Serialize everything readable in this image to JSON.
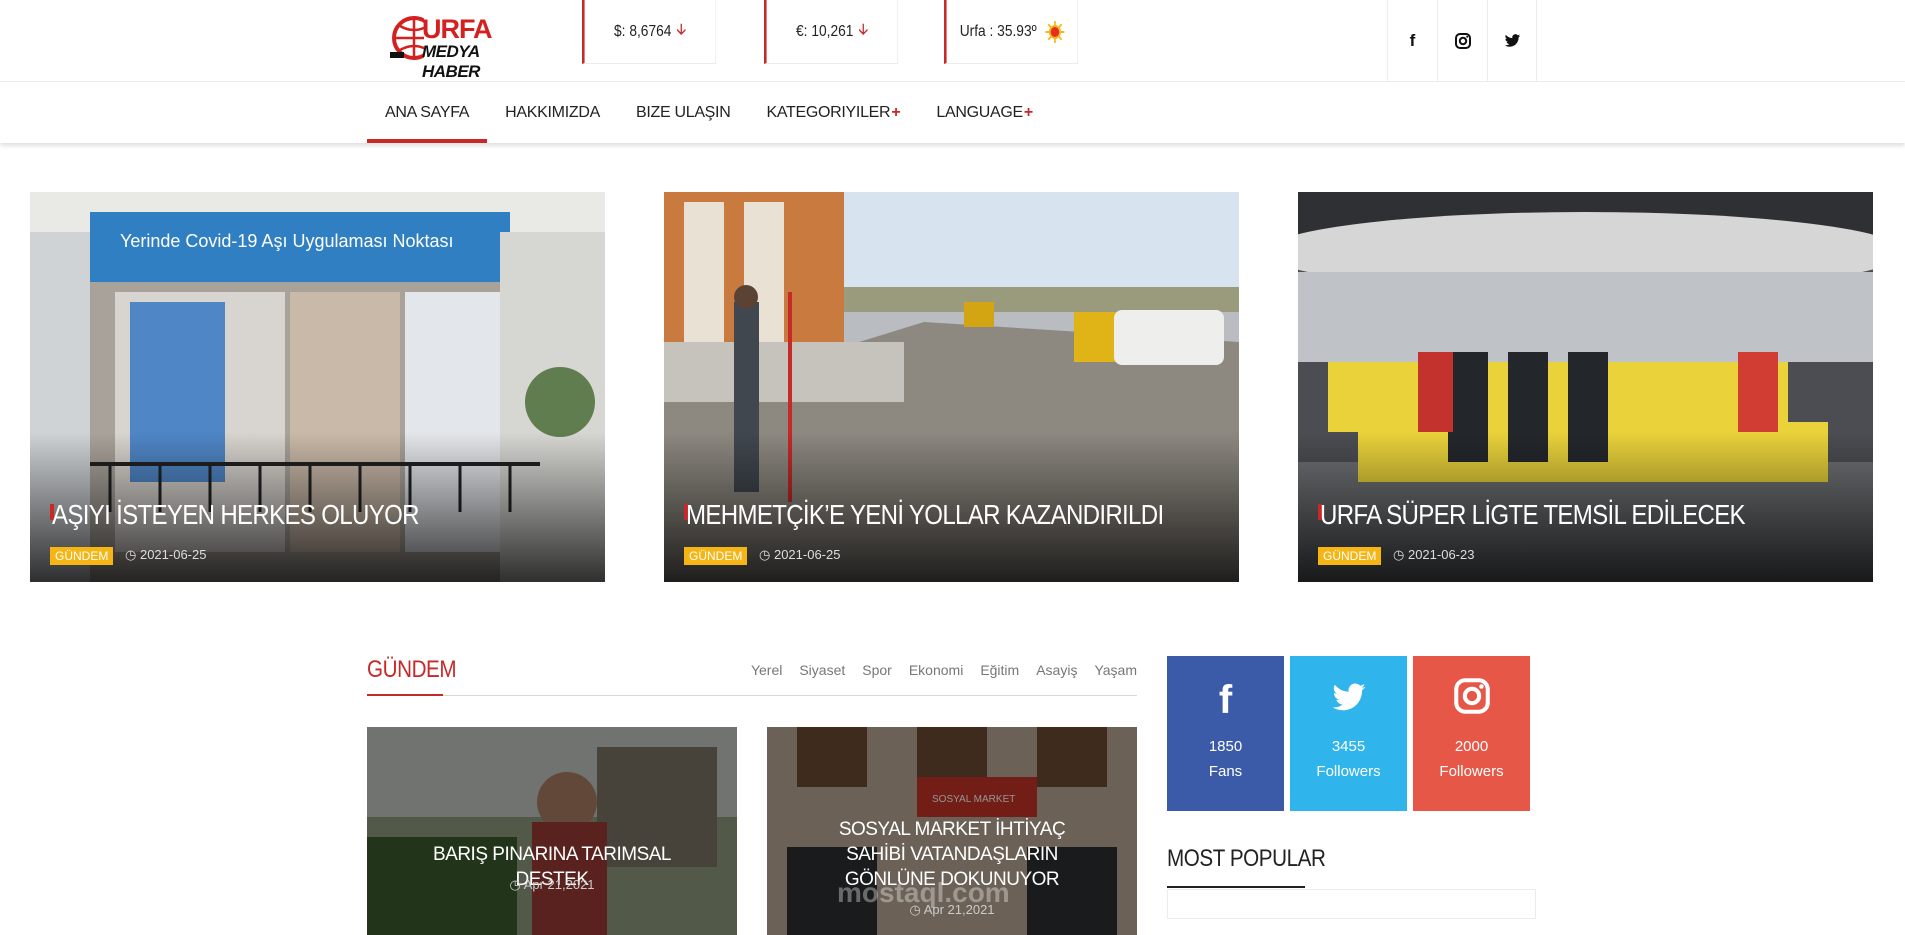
{
  "brand": {
    "top": "URFA",
    "bottom": "MEDYA HABER",
    "color": "#d4211f"
  },
  "tickers": [
    {
      "label": "$: 8,6764",
      "trend": "down"
    },
    {
      "label": "€: 10,261",
      "trend": "down"
    },
    {
      "label": "Urfa : 35.93º",
      "icon": "sun-icon"
    }
  ],
  "social_top": [
    "f",
    "ig",
    "t"
  ],
  "nav": [
    {
      "label": "ANA SAYFA",
      "active": true,
      "plus": ""
    },
    {
      "label": "HAKKIMIZDA",
      "plus": ""
    },
    {
      "label": "BIZE ULAŞIN",
      "plus": ""
    },
    {
      "label": "KATEGORIYILER",
      "plus": "+"
    },
    {
      "label": "LANGUAGE",
      "plus": "+"
    }
  ],
  "slides": [
    {
      "title": "AŞIYI İSTEYEN HERKES OLUYOR",
      "category": "GÜNDEM",
      "date": "2021-06-25",
      "image_text": "Yerinde Covid-19 Aşı Uygulaması Noktası"
    },
    {
      "title": "MEHMETÇİK’E YENİ YOLLAR KAZANDIRILDI",
      "category": "GÜNDEM",
      "date": "2021-06-25"
    },
    {
      "title": "URFA SÜPER LİGTE TEMSİL EDİLECEK",
      "category": "GÜNDEM",
      "date": "2021-06-23"
    }
  ],
  "section": {
    "title": "GÜNDEM",
    "tabs": [
      "Yerel",
      "Siyaset",
      "Spor",
      "Ekonomi",
      "Eğitim",
      "Asayiş",
      "Yaşam"
    ]
  },
  "cards": [
    {
      "title": "BARIŞ PINARINA TARIMSAL DESTEK",
      "date": "Apr 21,2021"
    },
    {
      "title": "SOSYAL MARKET İHTİYAÇ SAHİBİ VATANDAŞLARIN GÖNLÜNE DOKUNUYOR",
      "date": "Apr 21,2021",
      "sign_text": "SOSYAL MARKET"
    }
  ],
  "social_counters": [
    {
      "icon": "facebook-icon",
      "count": "1850",
      "label": "Fans",
      "color": "#3b5ba9"
    },
    {
      "icon": "twitter-icon",
      "count": "3455",
      "label": "Followers",
      "color": "#2fb5ec"
    },
    {
      "icon": "instagram-icon",
      "count": "2000",
      "label": "Followers",
      "color": "#e65747"
    }
  ],
  "most_popular": {
    "title": "MOST POPULAR"
  },
  "watermark": "mostaql.com",
  "colors": {
    "accent": "#c62928",
    "category": "#f5b514"
  }
}
